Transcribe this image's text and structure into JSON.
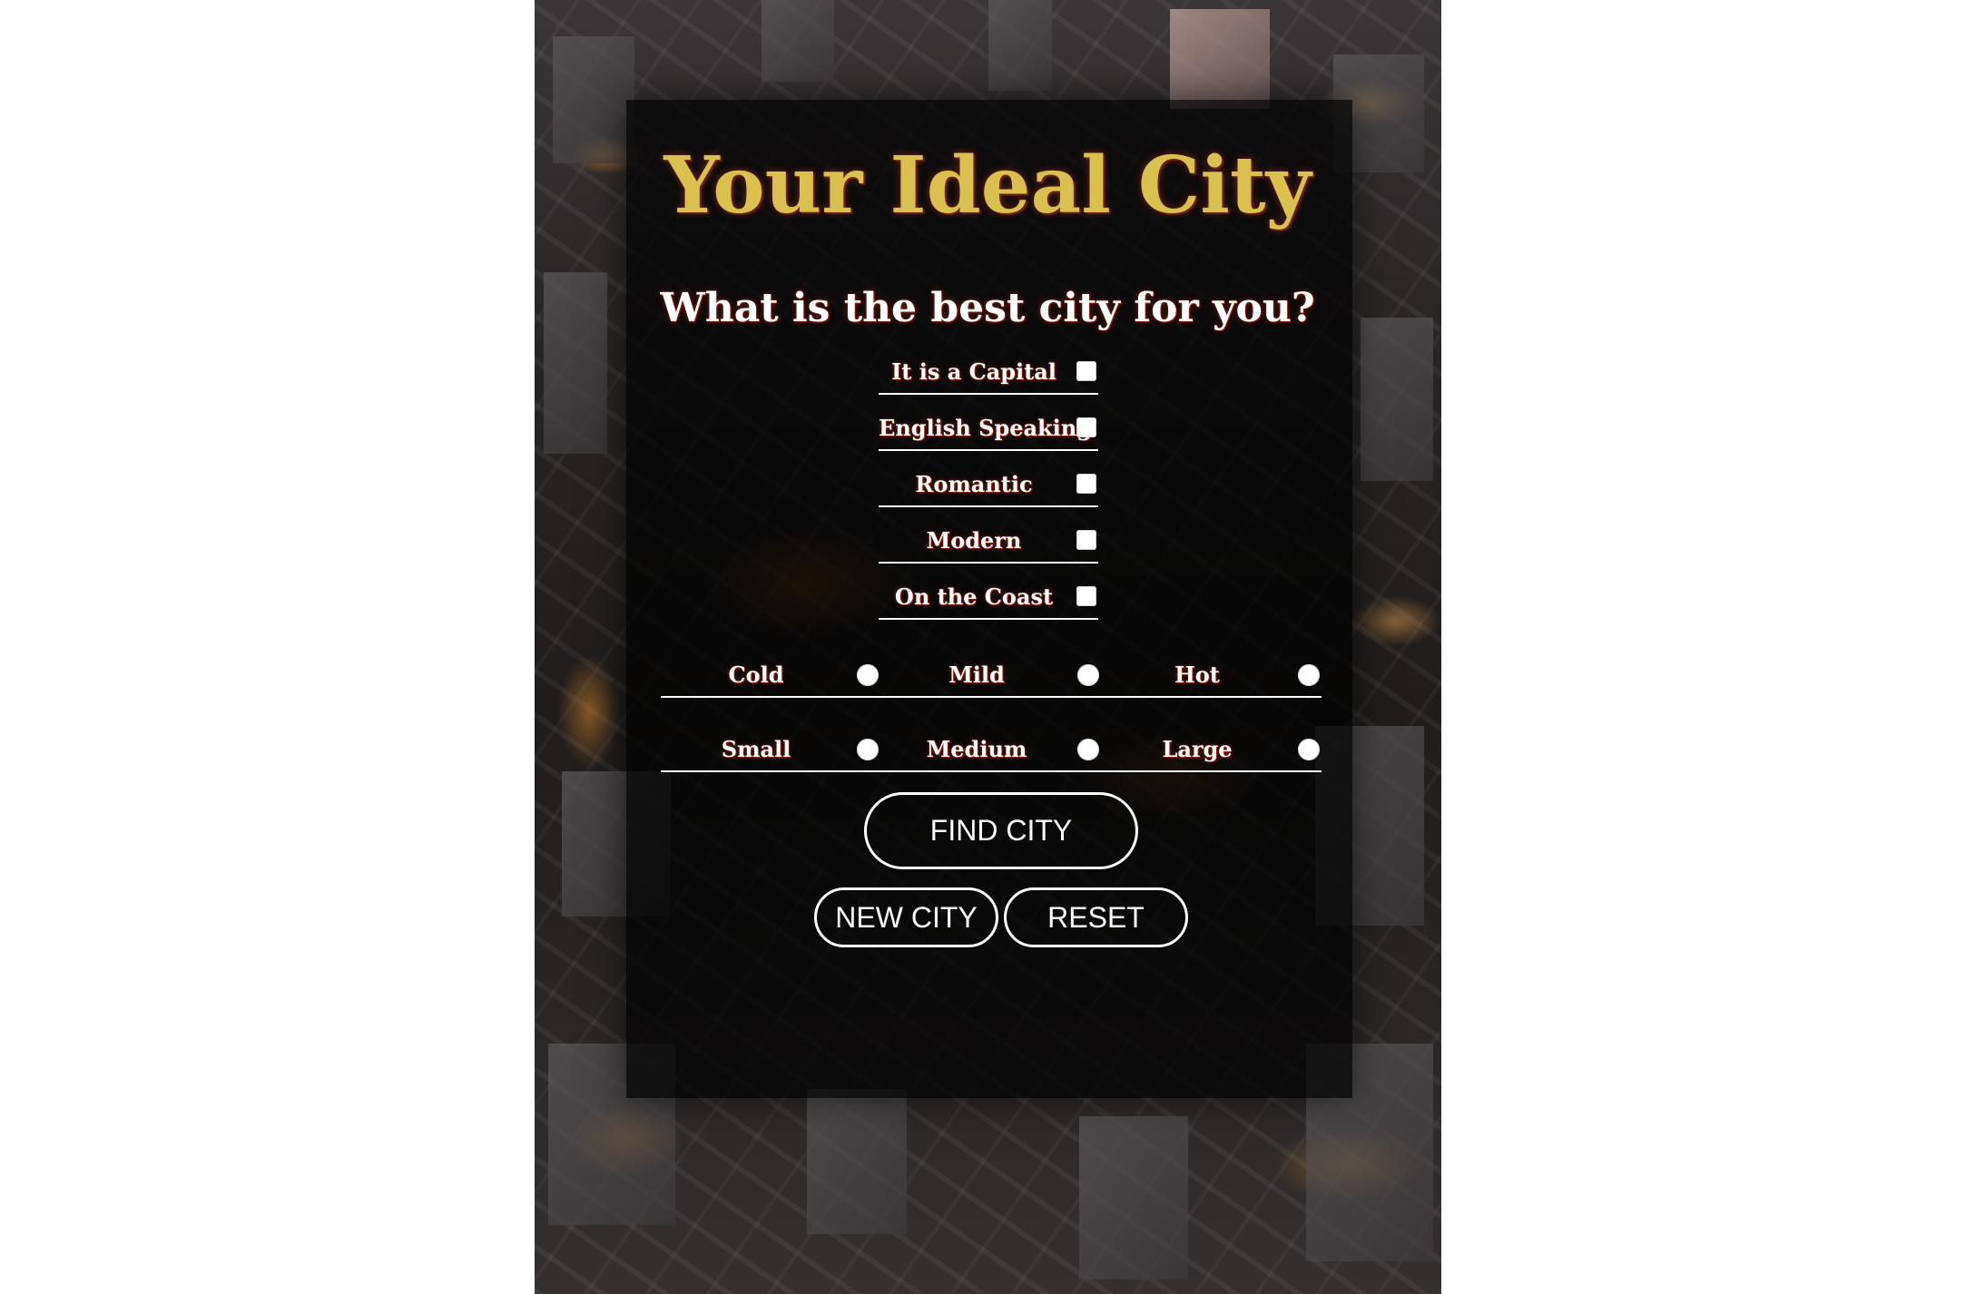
{
  "app": {
    "title": "Your Ideal City",
    "subtitle": "What is the best city for you?"
  },
  "checkboxes": [
    {
      "label": "It is a Capital",
      "checked": false
    },
    {
      "label": "English Speaking",
      "checked": false
    },
    {
      "label": "Romantic",
      "checked": false
    },
    {
      "label": "Modern",
      "checked": false
    },
    {
      "label": "On the Coast",
      "checked": false
    }
  ],
  "climate": [
    {
      "label": "Cold",
      "selected": false
    },
    {
      "label": "Mild",
      "selected": false
    },
    {
      "label": "Hot",
      "selected": false
    }
  ],
  "size": [
    {
      "label": "Small",
      "selected": false
    },
    {
      "label": "Medium",
      "selected": false
    },
    {
      "label": "Large",
      "selected": false
    }
  ],
  "buttons": {
    "find": "FIND CITY",
    "new_city": "NEW CITY",
    "reset": "RESET"
  },
  "colors": {
    "title": "#d9c04f",
    "text": "#ffffff",
    "glow": "#8a1e10"
  }
}
